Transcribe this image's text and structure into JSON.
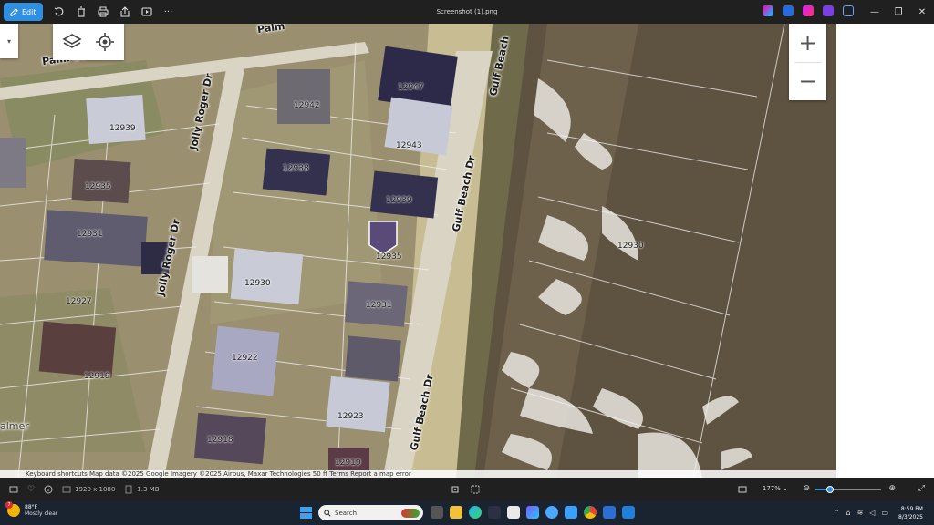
{
  "toolbar": {
    "edit_label": "Edit",
    "title": "Screenshot (1).png",
    "tools": [
      "rotate-icon",
      "delete-icon",
      "print-icon",
      "share-icon",
      "slideshow-icon",
      "more-icon"
    ],
    "more_label": "···"
  },
  "map": {
    "house_numbers": [
      "12947",
      "12942",
      "12943",
      "12939",
      "12938",
      "12939",
      "12935",
      "12931",
      "12930",
      "12935",
      "12931",
      "12930",
      "12927",
      "12922",
      "12919",
      "12923",
      "12918",
      "12919"
    ],
    "streets": {
      "palm": "Palm St",
      "jolly_roger_top": "Jolly Roger Dr",
      "jolly_roger_bottom": "Jolly Roger Dr",
      "gulf_beach_top": "Gulf Beach",
      "gulf_beach_mid": "Gulf Beach Dr",
      "gulf_beach_bottom": "Gulf Beach Dr",
      "palmer": "almer",
      "palm_partial": "Palm"
    },
    "water_label": "12930",
    "zoom_in": "+",
    "zoom_out": "−",
    "attribution": "Keyboard shortcuts   Map data ©2025 Google Imagery ©2025 Airbus, Maxar Technologies   50 ft   Terms   Report a map error"
  },
  "statusbar": {
    "dimensions": "1920 x 1080",
    "size": "1.3 MB",
    "zoom": "177%",
    "zoom_fraction": 0.22
  },
  "taskbar": {
    "weather_temp": "88°F",
    "weather_desc": "Mostly clear",
    "weather_badge": "7",
    "search_placeholder": "Search",
    "time": "8:59 PM",
    "date": "8/3/2025"
  },
  "colors": {
    "accent": "#2f8fe0",
    "pin": "#5a4a7a"
  }
}
